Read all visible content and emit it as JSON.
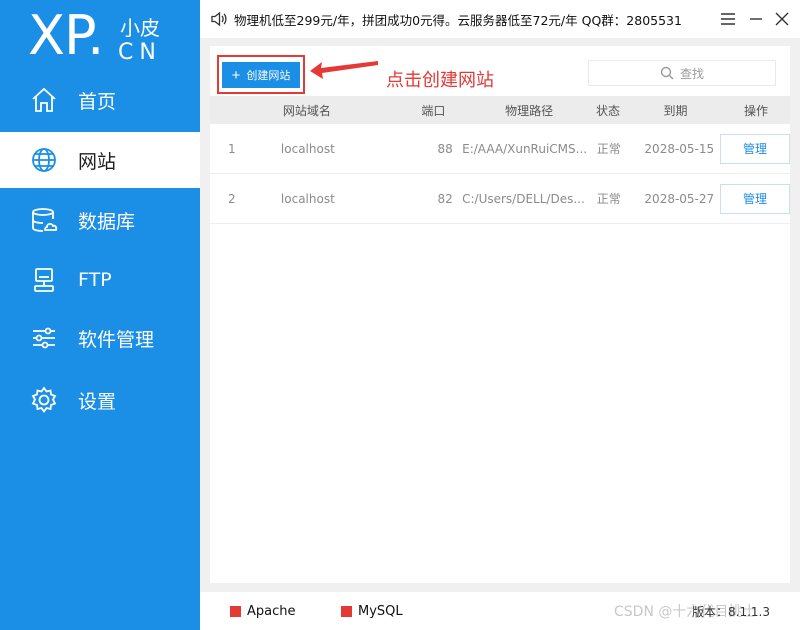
{
  "logo": {
    "main": "XP.",
    "small": "小皮",
    "sub": "CN"
  },
  "sidebar": {
    "items": [
      {
        "label": "首页",
        "icon": "home-icon"
      },
      {
        "label": "网站",
        "icon": "globe-icon",
        "active": true
      },
      {
        "label": "数据库",
        "icon": "database-icon"
      },
      {
        "label": "FTP",
        "icon": "ftp-icon"
      },
      {
        "label": "软件管理",
        "icon": "sliders-icon"
      },
      {
        "label": "设置",
        "icon": "gear-icon"
      }
    ]
  },
  "notice": {
    "text": "物理机低至299元/年，拼团成功0元得。云服务器低至72元/年  QQ群：2805531"
  },
  "toolbar": {
    "create_label": "创建网站",
    "annotation": "点击创建网站",
    "search_placeholder": "查找"
  },
  "table": {
    "headers": [
      "网站域名",
      "端口",
      "物理路径",
      "状态",
      "到期",
      "操作"
    ],
    "rows": [
      {
        "index": "1",
        "domain": "localhost",
        "port": "88",
        "path": "E:/AAA/XunRuiCMS...",
        "status": "正常",
        "expiry": "2028-05-15",
        "action": "管理"
      },
      {
        "index": "2",
        "domain": "localhost",
        "port": "82",
        "path": "C:/Users/DELL/Des...",
        "status": "正常",
        "expiry": "2028-05-27",
        "action": "管理"
      }
    ]
  },
  "footer": {
    "services": [
      {
        "name": "Apache"
      },
      {
        "name": "MySQL"
      }
    ],
    "watermark": "CSDN @十六代目挑士",
    "version": "版本：8.1.1.3"
  },
  "colors": {
    "accent": "#1b8ee6",
    "annotation": "#e53935",
    "status_stopped": "#e53935"
  }
}
